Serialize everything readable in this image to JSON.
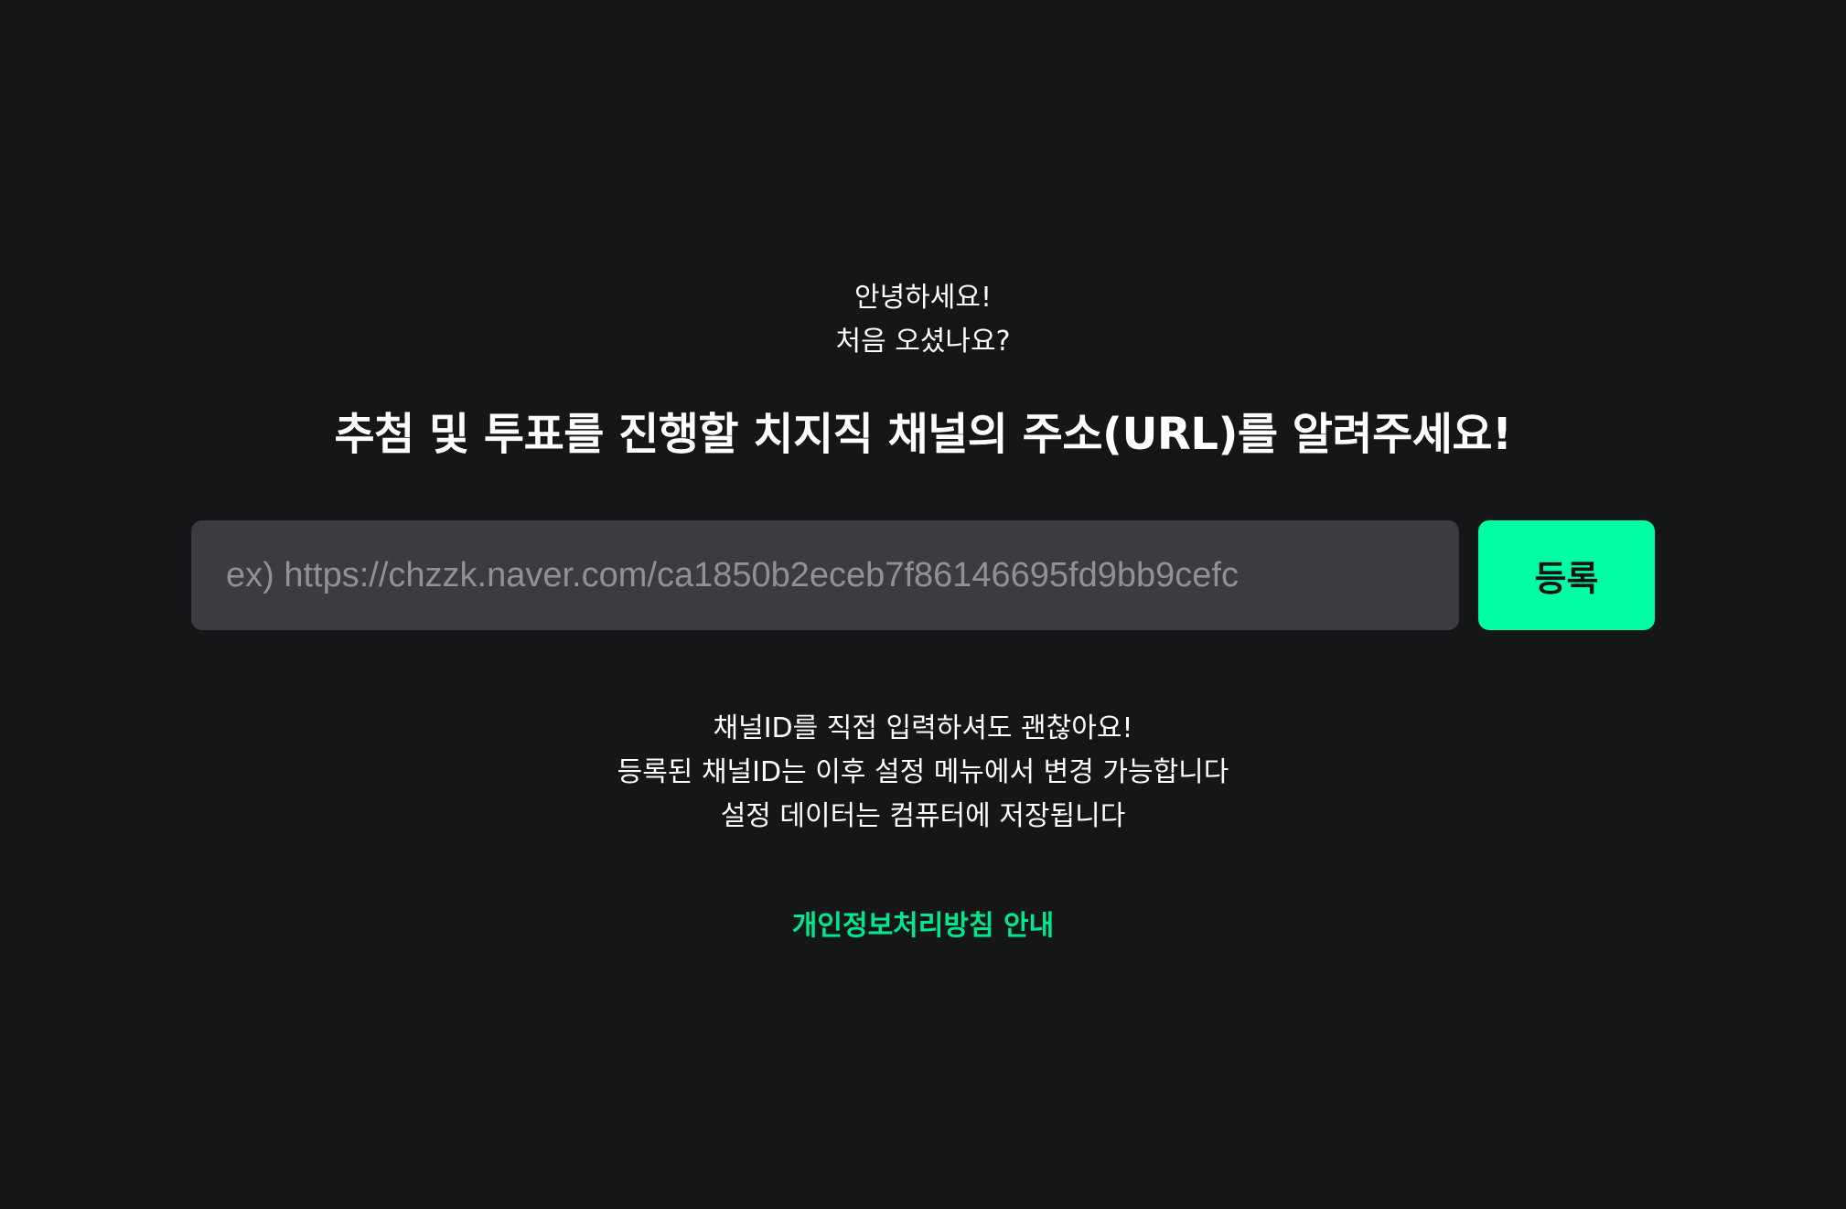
{
  "greeting": {
    "line1": "안녕하세요!",
    "line2": "처음 오셨나요?"
  },
  "heading": "추첨 및 투표를 진행할 치지직 채널의 주소(URL)를 알려주세요!",
  "channel_input": {
    "placeholder": "ex) https://chzzk.naver.com/ca1850b2eceb7f86146695fd9bb9cefc",
    "value": ""
  },
  "register_button_label": "등록",
  "info": {
    "line1": "채널ID를 직접 입력하셔도 괜찮아요!",
    "line2": "등록된 채널ID는 이후 설정 메뉴에서 변경 가능합니다",
    "line3": "설정 데이터는 컴퓨터에 저장됩니다"
  },
  "privacy_link_label": "개인정보처리방침 안내",
  "colors": {
    "background": "#151618",
    "input_background": "#3a3c41",
    "accent": "#00ffa3",
    "link": "#00e88f",
    "text": "#ffffff",
    "placeholder": "#8f9196"
  }
}
